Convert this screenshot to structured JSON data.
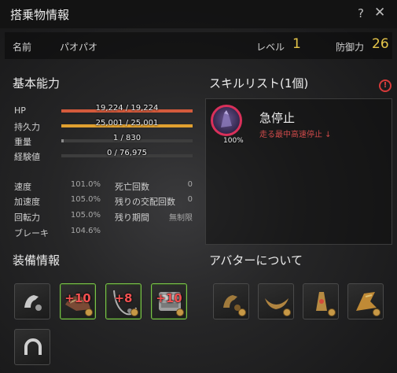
{
  "window": {
    "title": "搭乗物情報",
    "help_icon": "question-mark-icon",
    "close_icon": "close-x-icon"
  },
  "mount": {
    "name_label": "名前",
    "name_value": "パオパオ",
    "level_label": "レベル",
    "level_value": "1",
    "defense_label": "防御力",
    "defense_value": "26"
  },
  "basic_stats": {
    "title": "基本能力",
    "bars": [
      {
        "label": "HP",
        "text": "19,224 / 19,224",
        "fraction": 1.0,
        "color": "#d35a3c"
      },
      {
        "label": "持久力",
        "text": "25,001 / 25,001",
        "fraction": 1.0,
        "color": "#e0a030"
      },
      {
        "label": "重量",
        "text": "1 / 830",
        "fraction": 0.0012,
        "color": "#8a8a8a"
      },
      {
        "label": "経験値",
        "text": "0 / 76,975",
        "fraction": 0.0,
        "color": "#a8b840"
      }
    ],
    "left": [
      {
        "label": "速度",
        "value": "101.0%"
      },
      {
        "label": "加速度",
        "value": "105.0%"
      },
      {
        "label": "回転力",
        "value": "105.0%"
      },
      {
        "label": "ブレーキ",
        "value": "104.6%"
      }
    ],
    "right": [
      {
        "label": "死亡回数",
        "value": "0"
      },
      {
        "label": "残りの交配回数",
        "value": "0"
      },
      {
        "label": "残り期間",
        "value": "無制限"
      }
    ]
  },
  "skills": {
    "title": "スキルリスト(1個)",
    "warning_icon": "exclamation-circle-icon",
    "items": [
      {
        "name": "急停止",
        "percent": "100%",
        "desc": "走る最中高速停止 ↓",
        "icon": "sudden-stop-icon"
      }
    ]
  },
  "equipment": {
    "title": "装備情報",
    "slots": [
      {
        "icon": "stirrup-icon",
        "enhance": "",
        "highlighted": false
      },
      {
        "icon": "saddle-icon",
        "enhance": "+10",
        "highlighted": true
      },
      {
        "icon": "reins-icon",
        "enhance": "+8",
        "highlighted": true
      },
      {
        "icon": "barding-icon",
        "enhance": "+10",
        "highlighted": true
      },
      {
        "icon": "horseshoe-icon",
        "enhance": "",
        "highlighted": false
      }
    ]
  },
  "avatar": {
    "title": "アバターについて",
    "slots": [
      {
        "icon": "avatar-stirrup-icon"
      },
      {
        "icon": "avatar-saddle-icon"
      },
      {
        "icon": "avatar-reins-icon"
      },
      {
        "icon": "avatar-armor-icon"
      }
    ]
  }
}
